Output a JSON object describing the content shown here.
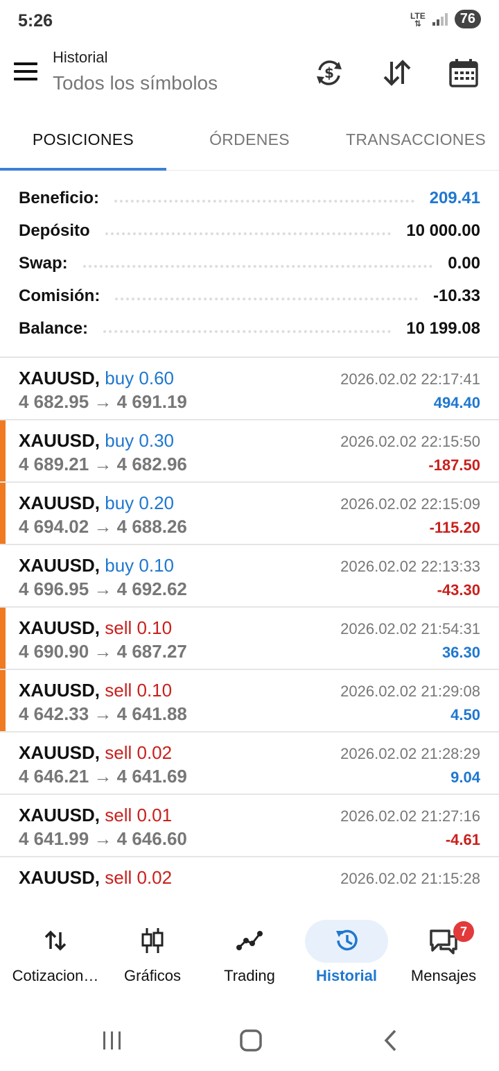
{
  "status_bar": {
    "time": "5:26",
    "network": "LTE",
    "battery": "76"
  },
  "header": {
    "title": "Historial",
    "subtitle": "Todos los símbolos",
    "icons": [
      "menu-icon",
      "currency-sync-icon",
      "sort-icon",
      "calendar-icon"
    ]
  },
  "tabs": [
    {
      "label": "POSICIONES",
      "active": true
    },
    {
      "label": "ÓRDENES",
      "active": false
    },
    {
      "label": "TRANSACCIONES",
      "active": false
    }
  ],
  "summary": {
    "profit": {
      "label": "Beneficio:",
      "value": "209.41"
    },
    "deposit": {
      "label": "Depósito",
      "value": "10 000.00"
    },
    "swap": {
      "label": "Swap:",
      "value": "0.00"
    },
    "commission": {
      "label": "Comisión:",
      "value": "-10.33"
    },
    "balance": {
      "label": "Balance:",
      "value": "10 199.08"
    }
  },
  "deals": [
    {
      "symbol": "XAUUSD,",
      "side": "buy 0.60",
      "type": "buy",
      "prices": "4 682.95 → 4 691.19",
      "time": "2026.02.02 22:17:41",
      "profit": "494.40",
      "profit_sign": "pos",
      "marked": false
    },
    {
      "symbol": "XAUUSD,",
      "side": "buy 0.30",
      "type": "buy",
      "prices": "4 689.21 → 4 682.96",
      "time": "2026.02.02 22:15:50",
      "profit": "-187.50",
      "profit_sign": "neg",
      "marked": true
    },
    {
      "symbol": "XAUUSD,",
      "side": "buy 0.20",
      "type": "buy",
      "prices": "4 694.02 → 4 688.26",
      "time": "2026.02.02 22:15:09",
      "profit": "-115.20",
      "profit_sign": "neg",
      "marked": true
    },
    {
      "symbol": "XAUUSD,",
      "side": "buy 0.10",
      "type": "buy",
      "prices": "4 696.95 → 4 692.62",
      "time": "2026.02.02 22:13:33",
      "profit": "-43.30",
      "profit_sign": "neg",
      "marked": false
    },
    {
      "symbol": "XAUUSD,",
      "side": "sell 0.10",
      "type": "sell",
      "prices": "4 690.90 → 4 687.27",
      "time": "2026.02.02 21:54:31",
      "profit": "36.30",
      "profit_sign": "pos",
      "marked": true
    },
    {
      "symbol": "XAUUSD,",
      "side": "sell 0.10",
      "type": "sell",
      "prices": "4 642.33 → 4 641.88",
      "time": "2026.02.02 21:29:08",
      "profit": "4.50",
      "profit_sign": "pos",
      "marked": true
    },
    {
      "symbol": "XAUUSD,",
      "side": "sell 0.02",
      "type": "sell",
      "prices": "4 646.21 → 4 641.69",
      "time": "2026.02.02 21:28:29",
      "profit": "9.04",
      "profit_sign": "pos",
      "marked": false
    },
    {
      "symbol": "XAUUSD,",
      "side": "sell 0.01",
      "type": "sell",
      "prices": "4 641.99 → 4 646.60",
      "time": "2026.02.02 21:27:16",
      "profit": "-4.61",
      "profit_sign": "neg",
      "marked": false
    },
    {
      "symbol": "XAUUSD,",
      "side": "sell 0.02",
      "type": "sell",
      "prices": "",
      "time": "2026.02.02 21:15:28",
      "profit": "",
      "profit_sign": "pos",
      "marked": false
    }
  ],
  "bottom_nav": [
    {
      "label": "Cotizacion…",
      "icon": "quotes-icon",
      "active": false
    },
    {
      "label": "Gráficos",
      "icon": "charts-icon",
      "active": false
    },
    {
      "label": "Trading",
      "icon": "trading-icon",
      "active": false
    },
    {
      "label": "Historial",
      "icon": "history-icon",
      "active": true
    },
    {
      "label": "Mensajes",
      "icon": "messages-icon",
      "active": false,
      "badge": "7"
    }
  ],
  "colors": {
    "accent": "#1f77d0",
    "negative": "#c9201c",
    "marker": "#f07a22",
    "tab_indicator": "#3d7fd6"
  }
}
